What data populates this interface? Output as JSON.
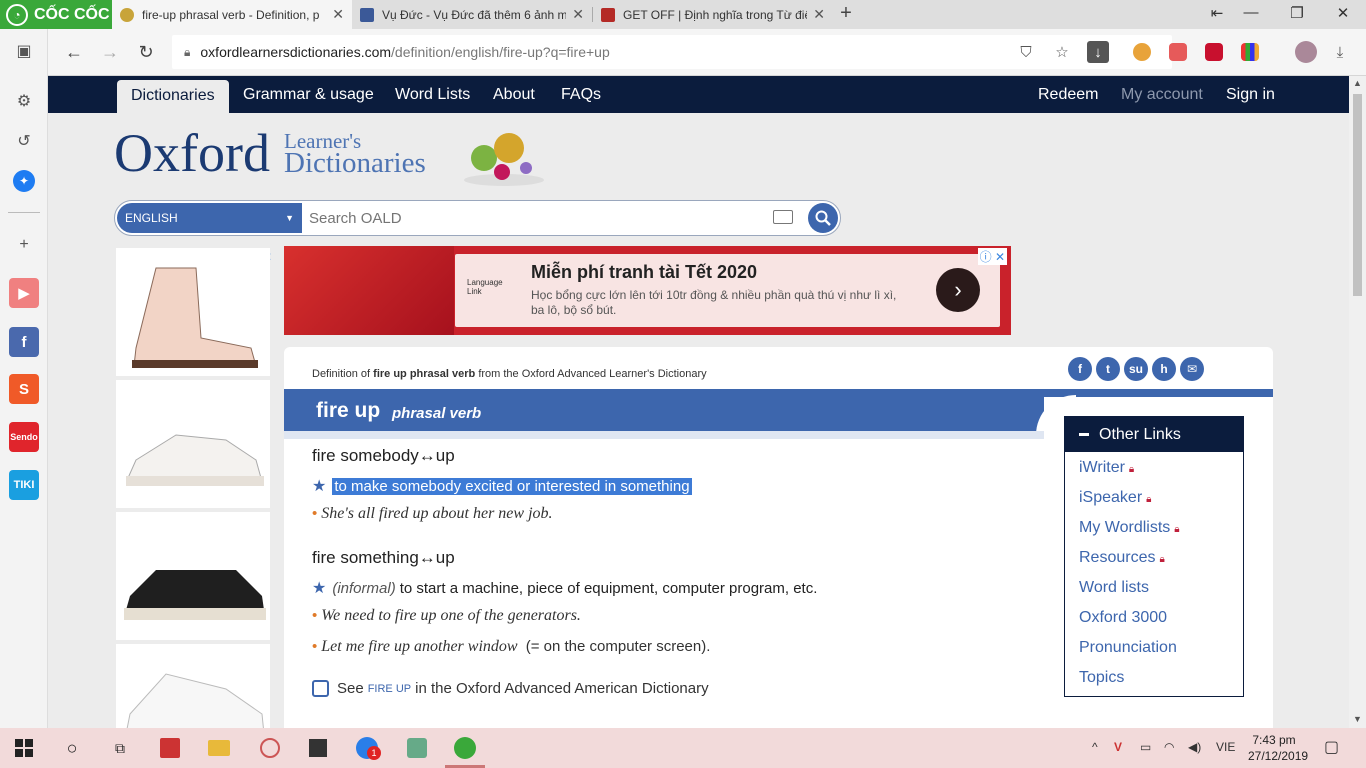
{
  "browser": {
    "brand": "CỐC CỐC",
    "tabs": [
      {
        "title": "fire-up phrasal verb - Definition, p",
        "active": true,
        "favicon_color": "#c8a43a"
      },
      {
        "title": "Vụ Đức - Vụ Đức đã thêm 6 ảnh m",
        "active": false,
        "favicon_color": "#3b5998"
      },
      {
        "title": "GET OFF | Định nghĩa trong Từ điể",
        "active": false,
        "favicon_color": "#b42a26"
      }
    ],
    "url_domain": "oxfordlearnersdictionaries.com",
    "url_path": "/definition/english/fire-up?q=fire+up"
  },
  "site": {
    "nav": {
      "left": [
        "Dictionaries",
        "Grammar & usage",
        "Word Lists",
        "About",
        "FAQs"
      ],
      "right": [
        "Redeem",
        "My account",
        "Sign in"
      ]
    },
    "logo": {
      "oxford": "Oxford",
      "learners": "Learner's",
      "dictionaries": "Dictionaries"
    },
    "search": {
      "language": "ENGLISH",
      "placeholder": "Search OALD"
    },
    "banner": {
      "title": "Miễn phí tranh tài Tết 2020",
      "subtitle": "Học bổng cực lớn lên tới 10tr đồng & nhiều phần quà thú vị như lì xì, ba lô, bộ sổ bút."
    },
    "entry": {
      "definition_of_prefix": "Definition of",
      "definition_of_term": "fire up phrasal verb",
      "definition_of_suffix": "from the Oxford Advanced Learner's Dictionary",
      "headword": "fire up",
      "pos": "phrasal verb",
      "senses": [
        {
          "phrase": "fire somebody↔up",
          "def": "to make somebody excited or interested in something",
          "label": "",
          "examples": [
            {
              "text": "She's all fired up about her new job.",
              "gloss": ""
            }
          ]
        },
        {
          "phrase": "fire something↔up",
          "label": "(informal)",
          "def": "to start a machine, piece of equipment, computer program, etc.",
          "examples": [
            {
              "text": "We need to fire up one of the generators.",
              "gloss": ""
            },
            {
              "text": "Let me fire up another window",
              "gloss": "(= on the computer screen)."
            }
          ]
        }
      ],
      "see_prefix": "See",
      "see_term": "FIRE UP",
      "see_suffix": "in the Oxford Advanced American Dictionary"
    },
    "other_links": {
      "title": "Other Links",
      "items": [
        {
          "label": "iWriter",
          "locked": true
        },
        {
          "label": "iSpeaker",
          "locked": true
        },
        {
          "label": "My Wordlists",
          "locked": true
        },
        {
          "label": "Resources",
          "locked": true
        },
        {
          "label": "Word lists",
          "locked": false
        },
        {
          "label": "Oxford 3000",
          "locked": false
        },
        {
          "label": "Pronunciation",
          "locked": false
        },
        {
          "label": "Topics",
          "locked": false
        }
      ]
    }
  },
  "taskbar": {
    "time": "7:43 pm",
    "date": "27/12/2019",
    "lang": "VIE",
    "badge": "1"
  },
  "colors": {
    "oxford_navy": "#0b1c3d",
    "oxford_blue": "#3d66ad",
    "highlight": "#3d7bd6"
  }
}
